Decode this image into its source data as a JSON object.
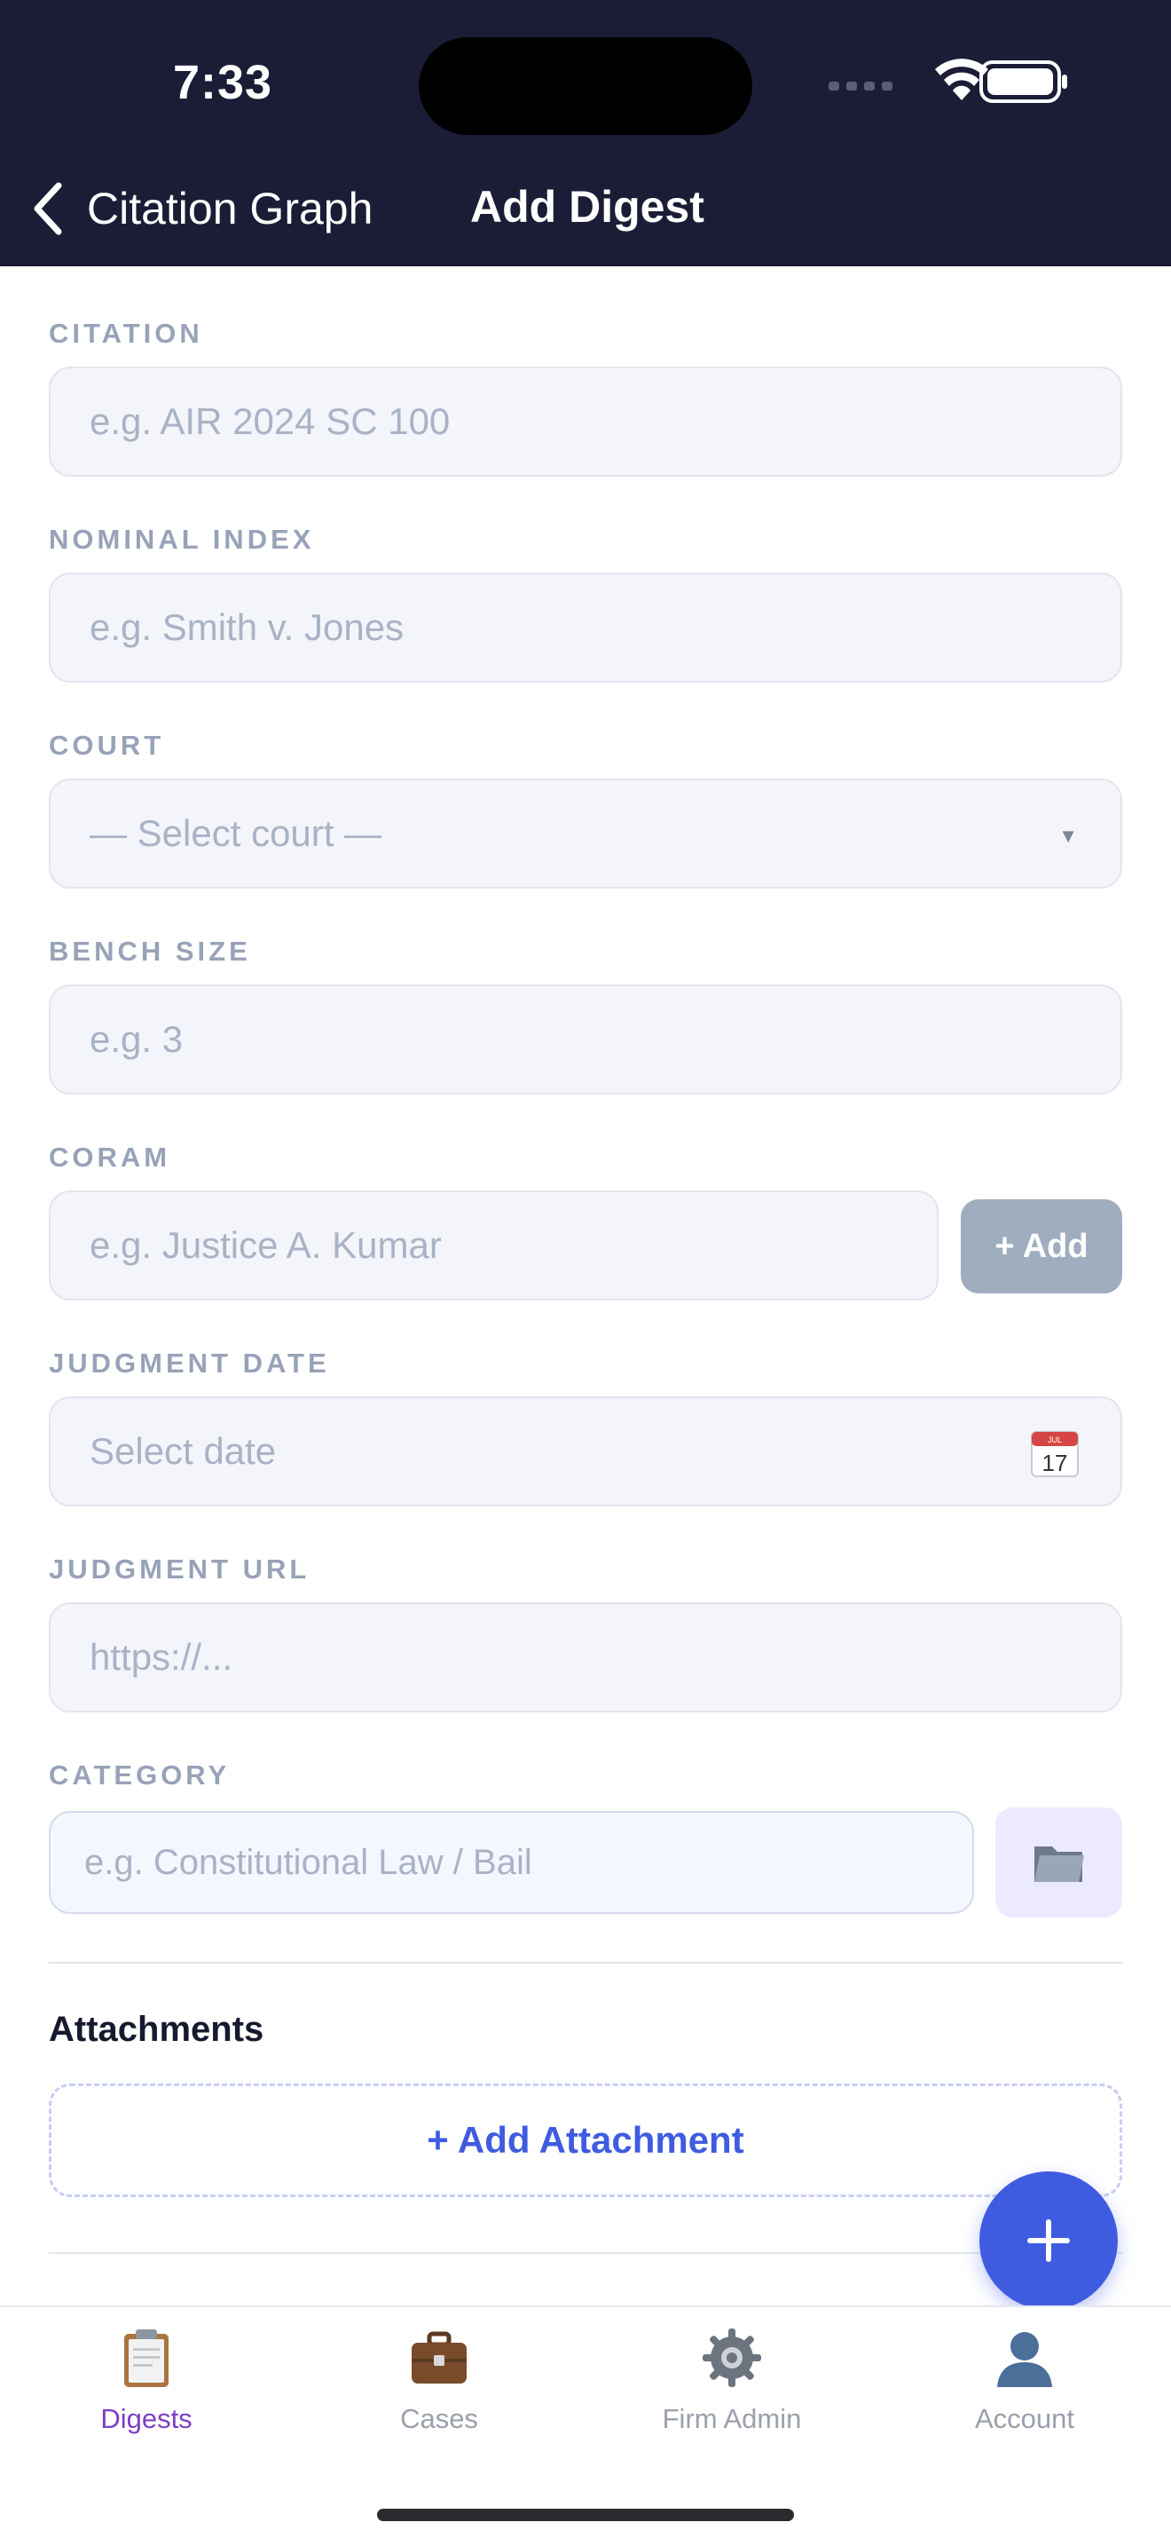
{
  "status_bar": {
    "time": "7:33"
  },
  "nav": {
    "back_label": "Citation Graph",
    "title": "Add Digest"
  },
  "form": {
    "citation": {
      "label": "CITATION",
      "placeholder": "e.g. AIR 2024 SC 100"
    },
    "nominal_index": {
      "label": "NOMINAL INDEX",
      "placeholder": "e.g. Smith v. Jones"
    },
    "court": {
      "label": "COURT",
      "placeholder": "— Select court —"
    },
    "bench_size": {
      "label": "BENCH SIZE",
      "placeholder": "e.g. 3"
    },
    "coram": {
      "label": "CORAM",
      "placeholder": "e.g. Justice A. Kumar",
      "add_label": "+ Add"
    },
    "judgment_date": {
      "label": "JUDGMENT DATE",
      "placeholder": "Select date",
      "calendar_day": "17",
      "calendar_month": "JUL"
    },
    "judgment_url": {
      "label": "JUDGMENT URL",
      "placeholder": "https://..."
    },
    "category": {
      "label": "CATEGORY",
      "placeholder": "e.g. Constitutional Law / Bail"
    }
  },
  "attachments": {
    "title": "Attachments",
    "add_label": "+ Add Attachment"
  },
  "tabs": [
    {
      "label": "Digests",
      "icon": "clipboard-icon",
      "active": true
    },
    {
      "label": "Cases",
      "icon": "briefcase-icon",
      "active": false
    },
    {
      "label": "Firm Admin",
      "icon": "gear-icon",
      "active": false
    },
    {
      "label": "Account",
      "icon": "user-silhouette-icon",
      "active": false
    }
  ],
  "colors": {
    "header_bg": "#1b1d36",
    "accent": "#3f5ce0",
    "tab_active": "#7c3fc7",
    "field_bg": "#f4f5fa",
    "label_gray": "#98a2b8"
  }
}
